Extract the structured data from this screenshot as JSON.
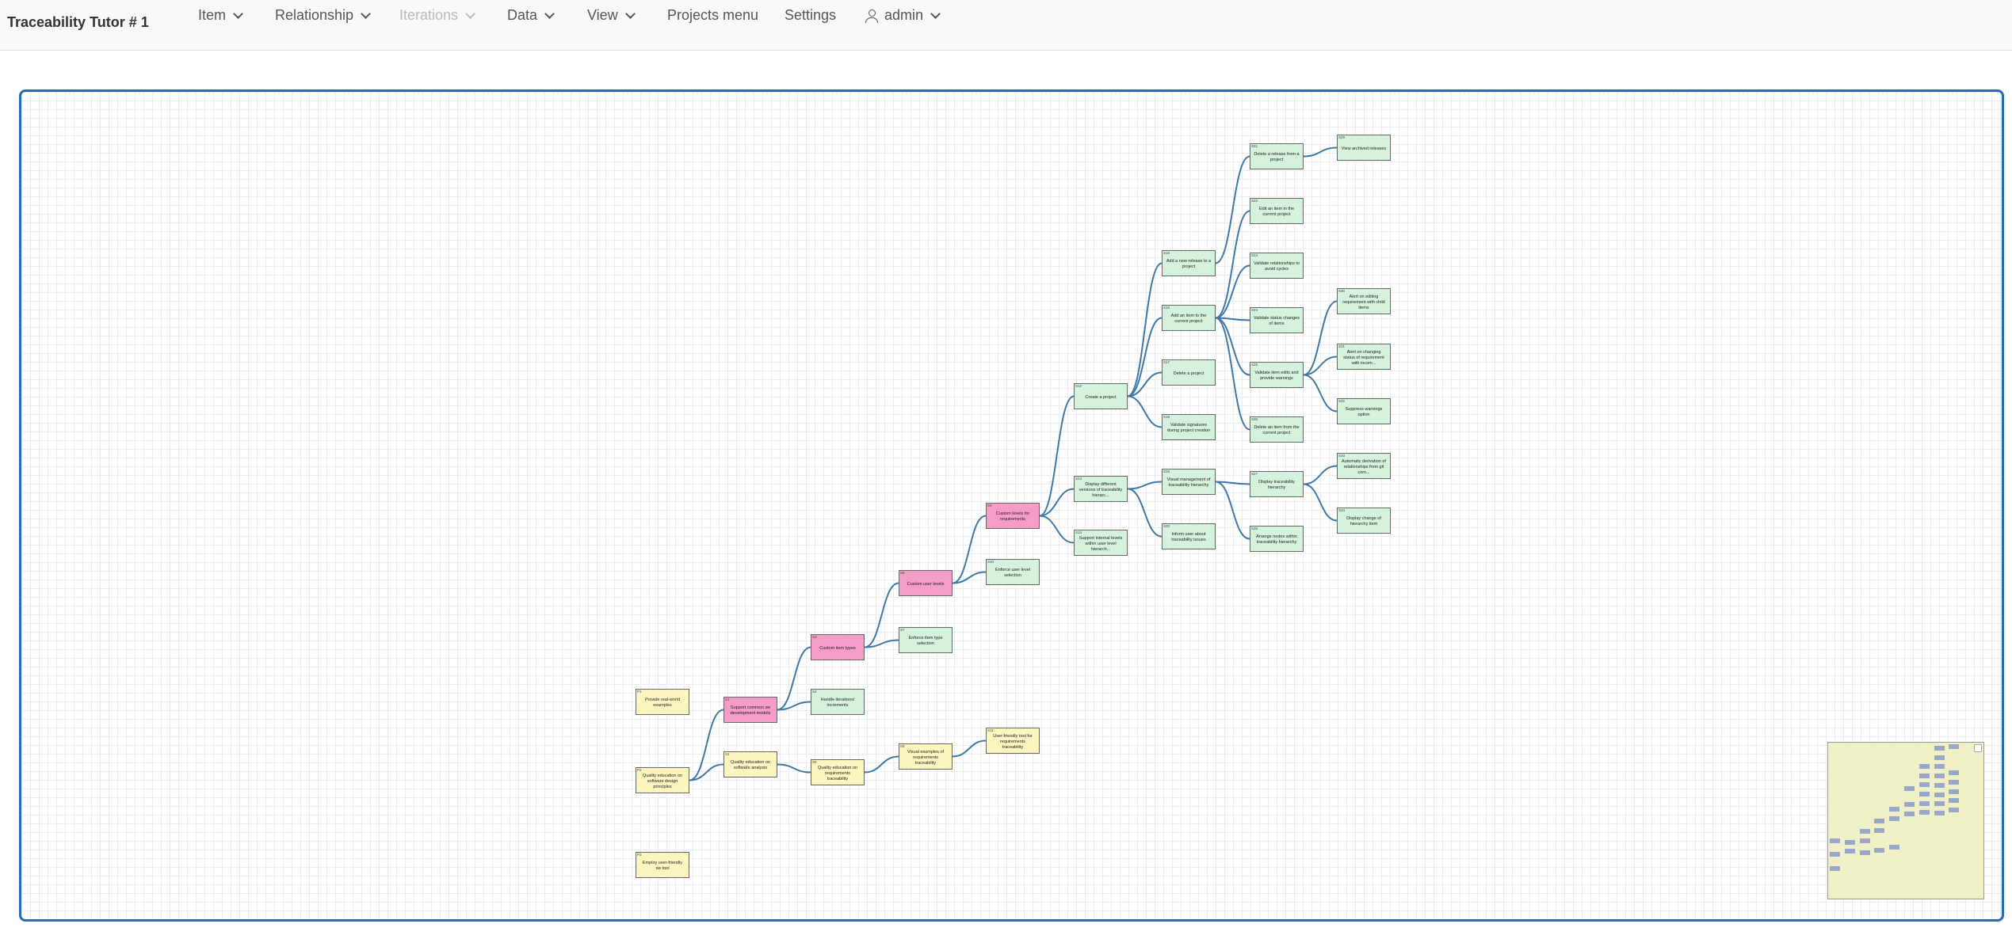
{
  "navbar": {
    "brand": "Traceability Tutor # 1",
    "items": [
      {
        "label": "Item",
        "dropdown": true,
        "disabled": false
      },
      {
        "label": "Relationship",
        "dropdown": true,
        "disabled": false
      },
      {
        "label": "Iterations",
        "dropdown": true,
        "disabled": true
      },
      {
        "label": "Data",
        "dropdown": true,
        "disabled": false
      },
      {
        "label": "View",
        "dropdown": true,
        "disabled": false
      },
      {
        "label": "Projects menu",
        "dropdown": false,
        "disabled": false
      },
      {
        "label": "Settings",
        "dropdown": false,
        "disabled": false
      }
    ],
    "user": {
      "label": "admin",
      "icon": "person-icon"
    }
  },
  "colors": {
    "accent_border": "#2a6bb0",
    "edge": "#3f78a6",
    "node_green": "#d4f2dc",
    "node_yellow": "#fdf5c0",
    "node_pink": "#f59cc8",
    "minimap_bg": "#f0f0c6",
    "minimap_node": "#9aa7c9"
  },
  "graph": {
    "nodes": [
      {
        "id": "n1",
        "tag": "P1",
        "label": "Provide real-world examples",
        "color": "yellow"
      },
      {
        "id": "n2",
        "tag": "P2",
        "label": "Quality education on software design principles",
        "color": "yellow"
      },
      {
        "id": "n3",
        "tag": "P3",
        "label": "Employ user-friendly sw tool",
        "color": "yellow"
      },
      {
        "id": "n4",
        "tag": "S1",
        "label": "Support common sw development models",
        "color": "pink"
      },
      {
        "id": "n5",
        "tag": "S2",
        "label": "Quality education on software analysis",
        "color": "yellow"
      },
      {
        "id": "n6",
        "tag": "S3",
        "label": "Custom item types",
        "color": "pink"
      },
      {
        "id": "n7",
        "tag": "S4",
        "label": "Handle iterations/ increments",
        "color": "green"
      },
      {
        "id": "n8",
        "tag": "S5",
        "label": "Quality education on requirements traceability",
        "color": "yellow"
      },
      {
        "id": "n9",
        "tag": "S6",
        "label": "Custom user levels",
        "color": "pink"
      },
      {
        "id": "n10",
        "tag": "S7",
        "label": "Enforce item type selection",
        "color": "green"
      },
      {
        "id": "n11",
        "tag": "S8",
        "label": "Visual examples of requirements traceability",
        "color": "yellow"
      },
      {
        "id": "n12",
        "tag": "S9",
        "label": "Custom levels for requirements",
        "color": "pink"
      },
      {
        "id": "n13",
        "tag": "S10",
        "label": "Enforce user level selection",
        "color": "green"
      },
      {
        "id": "n14",
        "tag": "S11",
        "label": "User-friendly tool for requirements traceability",
        "color": "yellow"
      },
      {
        "id": "n15",
        "tag": "S12",
        "label": "Create a project",
        "color": "green"
      },
      {
        "id": "n16",
        "tag": "S13",
        "label": "Display different versions of traceability hierarc...",
        "color": "green"
      },
      {
        "id": "n17",
        "tag": "S14",
        "label": "Support internal levels within user level hierarch...",
        "color": "green"
      },
      {
        "id": "n18",
        "tag": "S15",
        "label": "Add a new release to a project",
        "color": "green"
      },
      {
        "id": "n19",
        "tag": "S16",
        "label": "Add an item to the current project",
        "color": "green"
      },
      {
        "id": "n20",
        "tag": "S17",
        "label": "Delete a project",
        "color": "green"
      },
      {
        "id": "n21",
        "tag": "S18",
        "label": "Validate signatures during project creation",
        "color": "green"
      },
      {
        "id": "n22",
        "tag": "S19",
        "label": "Visual management of traceability hierarchy",
        "color": "green"
      },
      {
        "id": "n23",
        "tag": "S20",
        "label": "Inform user about traceability issues",
        "color": "green"
      },
      {
        "id": "n24",
        "tag": "S21",
        "label": "Delete a release from a project",
        "color": "green"
      },
      {
        "id": "n25",
        "tag": "S22",
        "label": "Edit an item in the current project",
        "color": "green"
      },
      {
        "id": "n26",
        "tag": "S23",
        "label": "Validate relationships to avoid cycles",
        "color": "green"
      },
      {
        "id": "n27",
        "tag": "S24",
        "label": "Validate status changes of items",
        "color": "green"
      },
      {
        "id": "n28",
        "tag": "S25",
        "label": "Validate item edits and provide warnings",
        "color": "green"
      },
      {
        "id": "n29",
        "tag": "S26",
        "label": "Delete an item from the current project",
        "color": "green"
      },
      {
        "id": "n30",
        "tag": "S27",
        "label": "Display traceability hierarchy",
        "color": "green"
      },
      {
        "id": "n31",
        "tag": "S28",
        "label": "Arrange nodes within traceability hierarchy",
        "color": "green"
      },
      {
        "id": "n32",
        "tag": "S29",
        "label": "View archived releases",
        "color": "green"
      },
      {
        "id": "n33",
        "tag": "S30",
        "label": "Alert on editing requirement with child items",
        "color": "green"
      },
      {
        "id": "n34",
        "tag": "S31",
        "label": "Alert on changing status of requirement with incom...",
        "color": "green"
      },
      {
        "id": "n35",
        "tag": "S32",
        "label": "Suppress warnings option",
        "color": "green"
      },
      {
        "id": "n36",
        "tag": "S33",
        "label": "Automatic derivation of relationships from git com...",
        "color": "green"
      },
      {
        "id": "n37",
        "tag": "S34",
        "label": "Display change of hierarchy item",
        "color": "green"
      }
    ],
    "edges": [
      [
        "n2",
        "n4"
      ],
      [
        "n2",
        "n5"
      ],
      [
        "n4",
        "n6"
      ],
      [
        "n4",
        "n7"
      ],
      [
        "n5",
        "n8"
      ],
      [
        "n6",
        "n9"
      ],
      [
        "n6",
        "n10"
      ],
      [
        "n8",
        "n11"
      ],
      [
        "n9",
        "n12"
      ],
      [
        "n9",
        "n13"
      ],
      [
        "n11",
        "n14"
      ],
      [
        "n12",
        "n15"
      ],
      [
        "n12",
        "n16"
      ],
      [
        "n12",
        "n17"
      ],
      [
        "n15",
        "n18"
      ],
      [
        "n15",
        "n19"
      ],
      [
        "n15",
        "n20"
      ],
      [
        "n15",
        "n21"
      ],
      [
        "n16",
        "n22"
      ],
      [
        "n16",
        "n23"
      ],
      [
        "n18",
        "n24"
      ],
      [
        "n19",
        "n25"
      ],
      [
        "n19",
        "n26"
      ],
      [
        "n19",
        "n27"
      ],
      [
        "n19",
        "n28"
      ],
      [
        "n19",
        "n29"
      ],
      [
        "n22",
        "n30"
      ],
      [
        "n22",
        "n31"
      ],
      [
        "n24",
        "n32"
      ],
      [
        "n28",
        "n33"
      ],
      [
        "n28",
        "n34"
      ],
      [
        "n28",
        "n35"
      ],
      [
        "n30",
        "n36"
      ],
      [
        "n30",
        "n37"
      ]
    ]
  },
  "minimap": {
    "label": "minimap"
  }
}
